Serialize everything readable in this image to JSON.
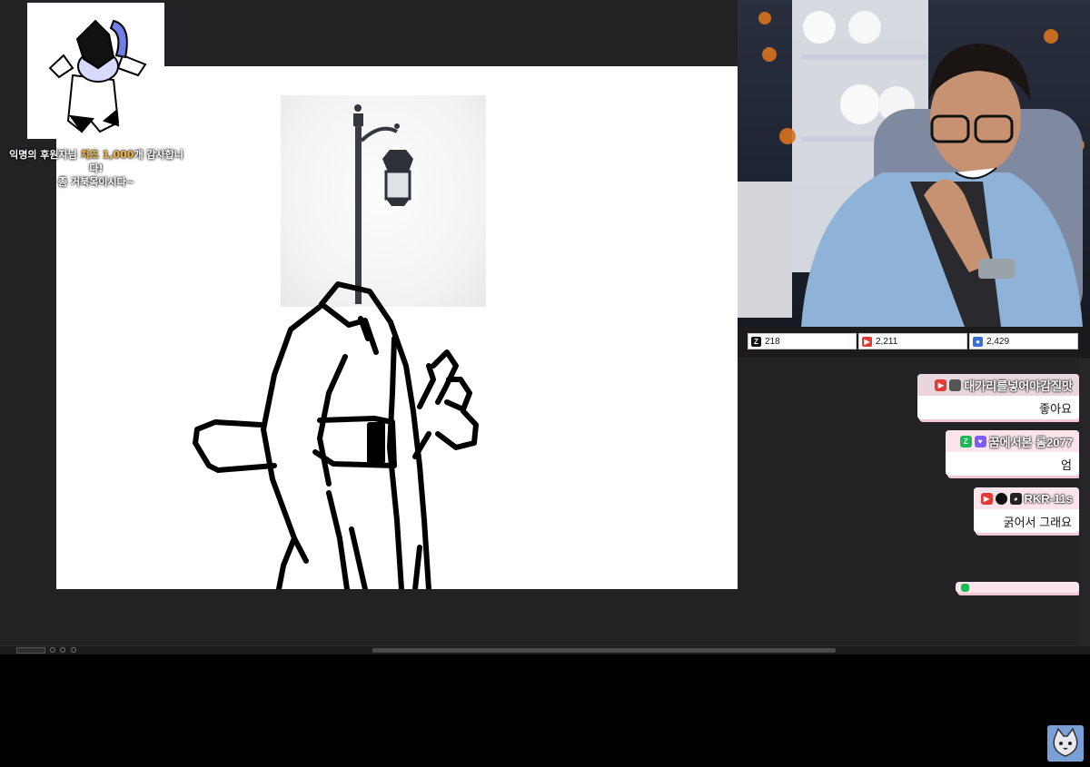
{
  "donation_alert": {
    "line1_prefix": "익명의 후원자님 ",
    "line1_highlight": "치즈 1,000",
    "line1_suffix": "개 감사합니다!",
    "line2": "좀 거북목이시다~"
  },
  "stats": {
    "chzzk_count": "218",
    "youtube_count": "2,211",
    "other_count": "2,429"
  },
  "chat": [
    {
      "nickname": "대가리를넣어야감질맛",
      "message": "좋아요",
      "badge_colors": [
        "#e53935",
        "#555555"
      ]
    },
    {
      "nickname": "꿈에서본 롬2077",
      "message": "엄",
      "badge_colors": [
        "#1db954",
        "#7c5cff"
      ]
    },
    {
      "nickname": "RKR-11s",
      "message": "굵어서 그래요",
      "badge_colors": [
        "#e53935",
        "#111111",
        "#222222"
      ]
    },
    {
      "nickname": "",
      "message": "",
      "badge_colors": [
        "#1db954"
      ]
    }
  ],
  "colors": {
    "app_bg": "#222224",
    "canvas_bg": "#ffffff",
    "highlight": "#f6b73c",
    "chat_shadow": "#f3c9d3",
    "chat_head": "#fce4ea"
  },
  "icons": {
    "chzzk": "chzzk-icon",
    "youtube": "youtube-icon",
    "other": "chat-platform-icon"
  }
}
